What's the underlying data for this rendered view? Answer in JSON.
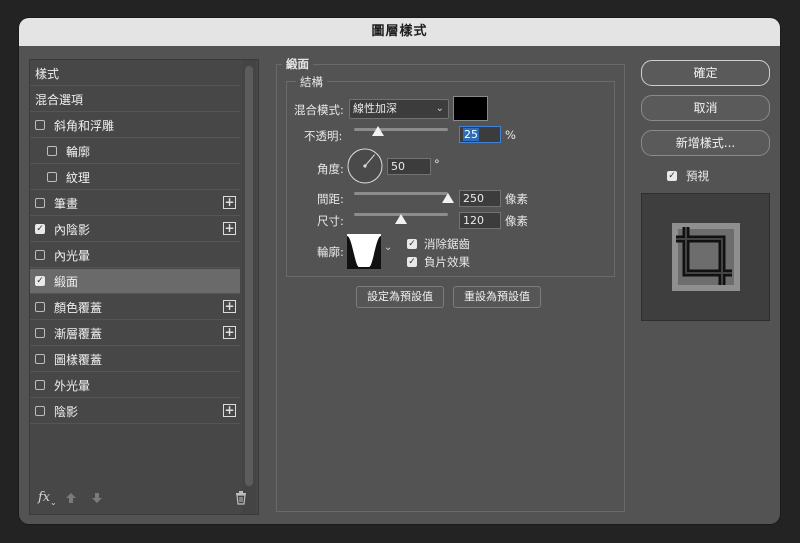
{
  "dialog": {
    "title": "圖層樣式"
  },
  "sidebar": {
    "items": [
      {
        "label": "樣式",
        "checkbox": false,
        "checked": false,
        "plus": false,
        "indent": 0,
        "selected": false
      },
      {
        "label": "混合選項",
        "checkbox": false,
        "checked": false,
        "plus": false,
        "indent": 0,
        "selected": false
      },
      {
        "label": "斜角和浮雕",
        "checkbox": true,
        "checked": false,
        "plus": false,
        "indent": 0,
        "selected": false
      },
      {
        "label": "輪廓",
        "checkbox": true,
        "checked": false,
        "plus": false,
        "indent": 1,
        "selected": false
      },
      {
        "label": "紋理",
        "checkbox": true,
        "checked": false,
        "plus": false,
        "indent": 1,
        "selected": false
      },
      {
        "label": "筆畫",
        "checkbox": true,
        "checked": false,
        "plus": true,
        "indent": 0,
        "selected": false
      },
      {
        "label": "內陰影",
        "checkbox": true,
        "checked": true,
        "plus": true,
        "indent": 0,
        "selected": false
      },
      {
        "label": "內光暈",
        "checkbox": true,
        "checked": false,
        "plus": false,
        "indent": 0,
        "selected": false
      },
      {
        "label": "緞面",
        "checkbox": true,
        "checked": true,
        "plus": false,
        "indent": 0,
        "selected": true
      },
      {
        "label": "顏色覆蓋",
        "checkbox": true,
        "checked": false,
        "plus": true,
        "indent": 0,
        "selected": false
      },
      {
        "label": "漸層覆蓋",
        "checkbox": true,
        "checked": false,
        "plus": true,
        "indent": 0,
        "selected": false
      },
      {
        "label": "圖樣覆蓋",
        "checkbox": true,
        "checked": false,
        "plus": false,
        "indent": 0,
        "selected": false
      },
      {
        "label": "外光暈",
        "checkbox": true,
        "checked": false,
        "plus": false,
        "indent": 0,
        "selected": false
      },
      {
        "label": "陰影",
        "checkbox": true,
        "checked": false,
        "plus": true,
        "indent": 0,
        "selected": false
      }
    ],
    "fx_label": "fx"
  },
  "satin": {
    "section_title": "緞面",
    "group_title": "結構",
    "blend_mode_label": "混合模式:",
    "blend_mode_value": "線性加深",
    "shadow_color": "#000000",
    "opacity_label": "不透明:",
    "opacity_value": "25",
    "opacity_unit": "%",
    "opacity_level": 25,
    "angle_label": "角度:",
    "angle_value": "50",
    "angle_unit": "°",
    "distance_label": "間距:",
    "distance_value": "250",
    "distance_unit": "像素",
    "distance_level": 100,
    "size_label": "尺寸:",
    "size_value": "120",
    "size_unit": "像素",
    "size_level": 50,
    "contour_label": "輪廓:",
    "anti_alias_label": "消除鋸齒",
    "anti_alias_checked": true,
    "invert_label": "負片效果",
    "invert_checked": true,
    "make_default_label": "設定為預設值",
    "reset_default_label": "重設為預設值"
  },
  "actions": {
    "ok_label": "確定",
    "cancel_label": "取消",
    "new_style_label": "新增樣式...",
    "preview_label": "預視",
    "preview_checked": true
  },
  "colors": {
    "dialog_bg": "#535353",
    "titlebar_bg": "#e4e4e4",
    "selected_row": "#6a6a6a",
    "accent_input": "#2e6db5"
  }
}
